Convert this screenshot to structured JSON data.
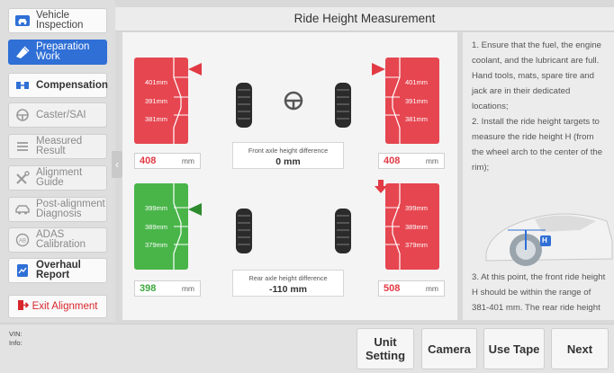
{
  "sidebar": {
    "items": [
      {
        "label": "Vehicle Inspection",
        "icon": "vehicle-inspection-icon",
        "state": "normal"
      },
      {
        "label": "Preparation Work",
        "icon": "preparation-icon",
        "state": "active"
      },
      {
        "label": "Compensation",
        "icon": "compensation-icon",
        "state": "bold"
      },
      {
        "label": "Caster/SAI",
        "icon": "steering-wheel-icon",
        "state": "disabled"
      },
      {
        "label": "Measured Result",
        "icon": "list-icon",
        "state": "disabled"
      },
      {
        "label": "Alignment Guide",
        "icon": "tools-icon",
        "state": "disabled"
      },
      {
        "label": "Post-alignment Diagnosis",
        "icon": "car-icon",
        "state": "disabled"
      },
      {
        "label": "ADAS Calibration",
        "icon": "adas-icon",
        "state": "disabled"
      },
      {
        "label": "Overhaul Report",
        "icon": "report-icon",
        "state": "bold"
      }
    ],
    "exit_label": "Exit Alignment"
  },
  "page": {
    "title": "Ride Height Measurement"
  },
  "front": {
    "left": {
      "ticks": [
        "401mm",
        "391mm",
        "381mm"
      ],
      "value": "408",
      "unit": "mm",
      "status": "out-of-range"
    },
    "right": {
      "ticks": [
        "401mm",
        "391mm",
        "381mm"
      ],
      "value": "408",
      "unit": "mm",
      "status": "out-of-range"
    },
    "diff_label": "Front axle height difference",
    "diff_value": "0 mm"
  },
  "rear": {
    "left": {
      "ticks": [
        "399mm",
        "389mm",
        "379mm"
      ],
      "value": "398",
      "unit": "mm",
      "status": "in-range"
    },
    "right": {
      "ticks": [
        "399mm",
        "389mm",
        "379mm"
      ],
      "value": "508",
      "unit": "mm",
      "status": "out-of-range"
    },
    "diff_label": "Rear axle height difference",
    "diff_value": "-110 mm"
  },
  "instructions": {
    "step1": "1. Ensure that the fuel, the engine coolant, and the lubricant are full. Hand tools, mats, spare tire and jack are in their dedicated locations;",
    "step2": "2. Install the ride height targets to measure the ride height H (from the wheel arch to the center of the rim);",
    "step3": "3. At this point, the front ride height H should be within the range of 381-401 mm. The rear ride height",
    "car_marker": "H"
  },
  "footer": {
    "vin_label": "VIN:",
    "info_label": "Info:",
    "buttons": {
      "unit_setting": "Unit Setting",
      "camera": "Camera",
      "use_tape": "Use Tape",
      "next": "Next"
    }
  },
  "colors": {
    "accent": "#2f6fd6",
    "out_of_range": "#e64650",
    "in_range": "#49b549",
    "exit": "#d6262c"
  }
}
